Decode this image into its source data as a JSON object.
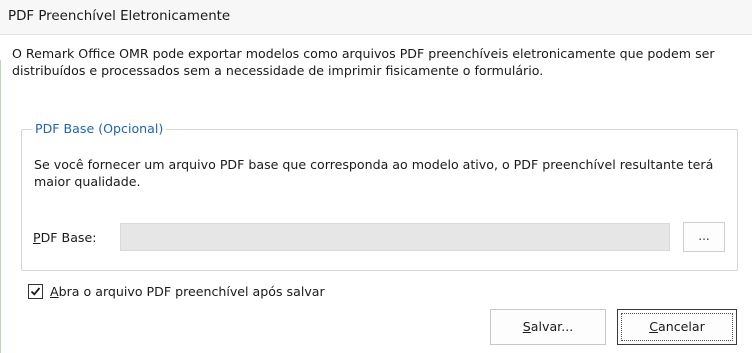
{
  "window": {
    "title": "PDF Preenchível Eletronicamente"
  },
  "description": "O Remark Office OMR pode exportar modelos como arquivos PDF preenchíveis eletronicamente que podem ser distribuídos e processados sem a necessidade de imprimir fisicamente o formulário.",
  "group": {
    "legend": "PDF Base (Opcional)",
    "description": "Se você fornecer um arquivo PDF base que corresponda ao modelo ativo, o PDF preenchível resultante terá maior qualidade.",
    "pdf_base_label_mnemonic": "P",
    "pdf_base_label_rest": "DF Base:",
    "pdf_base_value": "",
    "browse_label": "..."
  },
  "open_after_save": {
    "checked": true,
    "label_mnemonic": "A",
    "label_rest": "bra o arquivo PDF preenchível após salvar"
  },
  "buttons": {
    "save_mnemonic": "S",
    "save_rest": "alvar...",
    "cancel_mnemonic": "C",
    "cancel_rest": "ancelar"
  }
}
